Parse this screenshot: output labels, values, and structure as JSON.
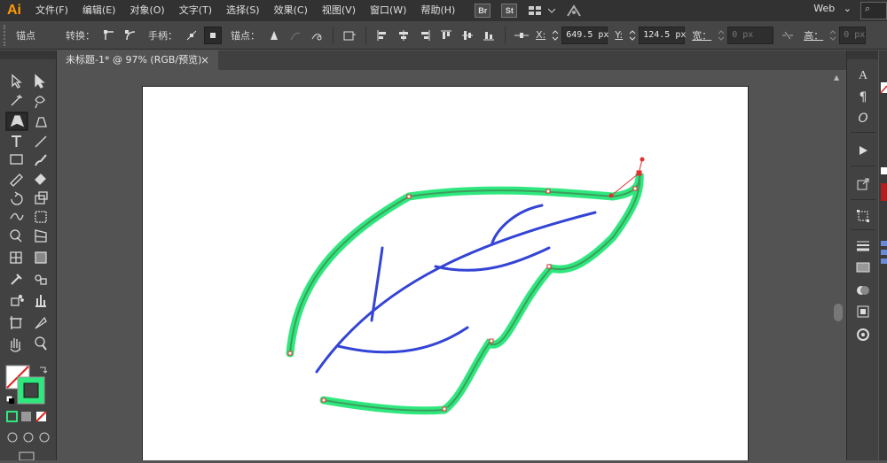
{
  "app": {
    "logo": "Ai"
  },
  "menu": [
    "文件(F)",
    "编辑(E)",
    "对象(O)",
    "文字(T)",
    "选择(S)",
    "效果(C)",
    "视图(V)",
    "窗口(W)",
    "帮助(H)"
  ],
  "bridge_buttons": [
    "Br",
    "St"
  ],
  "workspace": {
    "label": "Web"
  },
  "control": {
    "selection_label": "锚点",
    "convert_label": "转换：",
    "handles_label": "手柄：",
    "anchors_label": "锚点：",
    "x_label": "X:",
    "x_value": "649.5 px",
    "y_label": "Y:",
    "y_value": "124.5 px",
    "w_label": "宽：",
    "w_value": "0 px",
    "h_label": "高：",
    "h_value": "0 px"
  },
  "document": {
    "tab_title": "未标题-1* @ 97% (RGB/预览)",
    "close_glyph": "×"
  },
  "colors": {
    "menubar": "#323232",
    "panel": "#424242",
    "leaf_stroke_highlight": "#2ee87e",
    "leaf_stroke": "#3e9e5e",
    "vein_stroke": "#3344d6",
    "anchor": "#e03030",
    "artboard": "#ffffff"
  },
  "tools": [
    "selection-tool",
    "direct-selection-tool",
    "magic-wand-tool",
    "lasso-tool",
    "pen-tool",
    "curvature-tool",
    "type-tool",
    "line-segment-tool",
    "rectangle-tool",
    "paintbrush-tool",
    "pencil-tool",
    "eraser-tool",
    "rotate-tool",
    "scale-tool",
    "warp-tool",
    "free-transform-tool",
    "shape-builder-tool",
    "perspective-grid-tool",
    "mesh-tool",
    "gradient-tool",
    "eyedropper-tool",
    "blend-tool",
    "symbol-sprayer-tool",
    "column-graph-tool",
    "artboard-tool",
    "slice-tool",
    "hand-tool",
    "zoom-tool"
  ],
  "right_panel": {
    "char_glyph": "A",
    "para_glyph": "¶",
    "glyph_glyph": "O"
  }
}
